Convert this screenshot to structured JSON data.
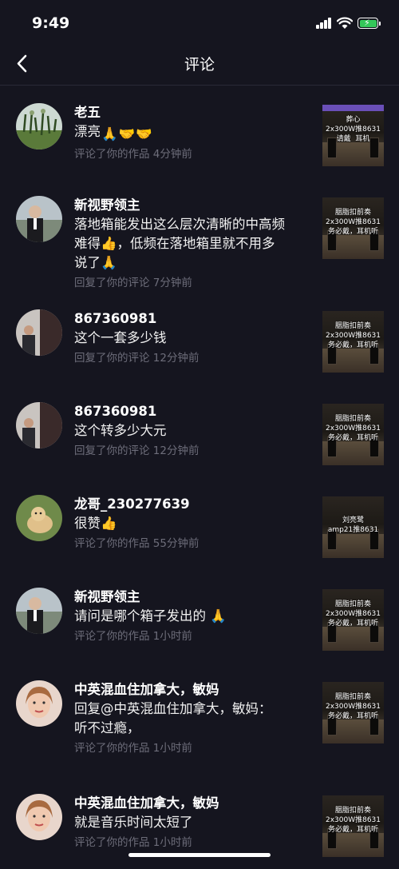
{
  "status": {
    "time": "9:49"
  },
  "header": {
    "title": "评论"
  },
  "items": [
    {
      "name": "老五",
      "comment": "漂亮",
      "emojis": [
        "🙏",
        "🤝",
        "🤝"
      ],
      "meta": "评论了你的作品  4分钟前",
      "thumb_caption": "葬心\n2x300W推8631\n请戴   耳机"
    },
    {
      "name": "新视野领主",
      "comment_lines": [
        "落地箱能发出这么层次清晰的中高频",
        "难得👍，低频在落地箱里就不用多",
        "说了🙏"
      ],
      "meta": "回复了你的评论  7分钟前",
      "thumb_caption": "胭脂扣前奏\n2x300W推8631\n务必戴，耳机听"
    },
    {
      "name": "867360981",
      "comment": "这个一套多少钱",
      "meta": "回复了你的评论  12分钟前",
      "thumb_caption": "胭脂扣前奏\n2x300W推8631\n务必戴，耳机听"
    },
    {
      "name": "867360981",
      "comment": "这个转多少大元",
      "meta": "回复了你的评论  12分钟前",
      "thumb_caption": "胭脂扣前奏\n2x300W推8631\n务必戴，耳机听"
    },
    {
      "name": "龙哥_230277639",
      "comment": "很赞👍",
      "meta": "评论了你的作品  55分钟前",
      "thumb_caption": "刘亮鹭\namp21推8631"
    },
    {
      "name": "新视野领主",
      "comment": "请问是哪个箱子发出的 🙏",
      "meta": "评论了你的作品  1小时前",
      "thumb_caption": "胭脂扣前奏\n2x300W推8631\n务必戴，耳机听"
    },
    {
      "name": "中英混血住加拿大，敏妈",
      "comment_lines": [
        "回复@中英混血住加拿大，敏妈：",
        "听不过瘾，"
      ],
      "meta": "评论了你的作品  1小时前",
      "thumb_caption": "胭脂扣前奏\n2x300W推8631\n务必戴，耳机听"
    },
    {
      "name": "中英混血住加拿大，敏妈",
      "comment": "就是音乐时间太短了",
      "meta": "评论了你的作品  1小时前",
      "thumb_caption": "胭脂扣前奏\n2x300W推8631\n务必戴，耳机听"
    }
  ]
}
